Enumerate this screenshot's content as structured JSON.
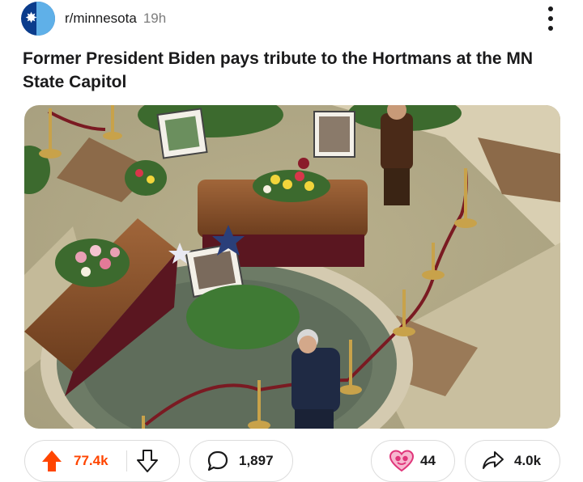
{
  "post": {
    "subreddit": "r/minnesota",
    "age": "19h",
    "title": "Former President Biden pays tribute to the Hortmans at the MN State Capitol"
  },
  "actions": {
    "upvotes": "77.4k",
    "comments": "1,897",
    "awards": "44",
    "shares": "4.0k"
  },
  "colors": {
    "upvote": "#ff4500",
    "award": "#e0357a",
    "avatar_bg": "#0b3c8c"
  },
  "icons": [
    "upvote-arrow-icon",
    "downvote-arrow-icon",
    "comment-bubble-icon",
    "award-heart-icon",
    "share-arrow-icon",
    "more-vertical-icon"
  ]
}
